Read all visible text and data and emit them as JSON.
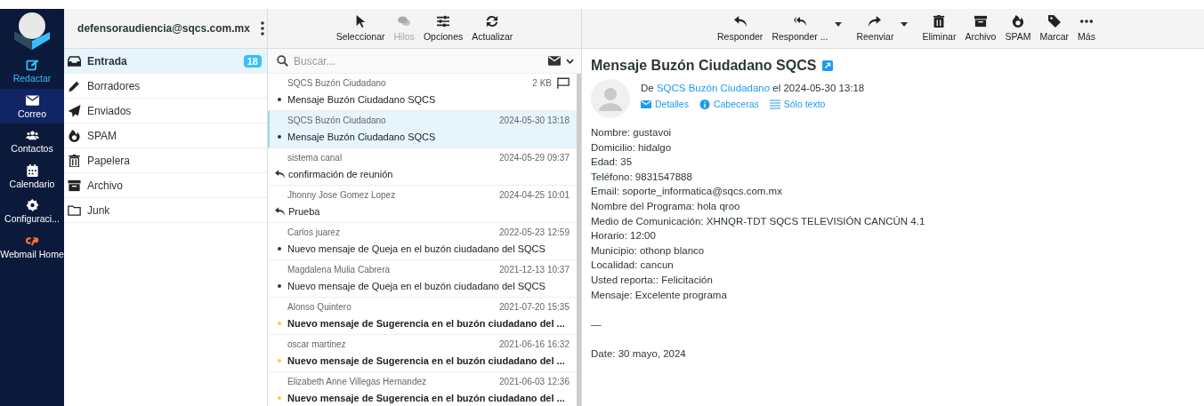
{
  "nav": [
    {
      "kind": "compose",
      "label": "Redactar",
      "selected": false,
      "accent": true
    },
    {
      "kind": "mail",
      "label": "Correo",
      "selected": true,
      "accent": false
    },
    {
      "kind": "contacts",
      "label": "Contactos",
      "selected": false,
      "accent": false
    },
    {
      "kind": "calendar",
      "label": "Calendario",
      "selected": false,
      "accent": false
    },
    {
      "kind": "settings",
      "label": "Configuraci...",
      "selected": false,
      "accent": false
    },
    {
      "kind": "cpanel",
      "label": "Webmail Home",
      "selected": false,
      "accent": false
    }
  ],
  "account": "defensoraudiencia@sqcs.com.mx",
  "folders": [
    {
      "kind": "inbox",
      "name": "Entrada",
      "selected": true,
      "count": "18"
    },
    {
      "kind": "drafts",
      "name": "Borradores",
      "selected": false
    },
    {
      "kind": "sent",
      "name": "Enviados",
      "selected": false
    },
    {
      "kind": "spam",
      "name": "SPAM",
      "selected": false
    },
    {
      "kind": "trash",
      "name": "Papelera",
      "selected": false
    },
    {
      "kind": "archive",
      "name": "Archivo",
      "selected": false
    },
    {
      "kind": "folder",
      "name": "Junk",
      "selected": false
    }
  ],
  "list_toolbar": [
    {
      "kind": "select",
      "label": "Seleccionar",
      "disabled": false
    },
    {
      "kind": "threads",
      "label": "Hilos",
      "disabled": true
    },
    {
      "kind": "options",
      "label": "Opciones",
      "disabled": false
    },
    {
      "kind": "refresh",
      "label": "Actualizar",
      "disabled": false
    }
  ],
  "search": {
    "placeholder": "Buscar..."
  },
  "messages": [
    {
      "from": "SQCS Buzón Ciudadano",
      "meta": "2 KB",
      "flag": true,
      "subject": "Mensaje Buzón Ciudadano SQCS",
      "kind": "read",
      "selected": false
    },
    {
      "from": "SQCS Buzón Ciudadano",
      "meta": "2024-05-30 13:18",
      "flag": false,
      "subject": "Mensaje Buzón Ciudadano SQCS",
      "kind": "read",
      "selected": true
    },
    {
      "from": "sistema canal",
      "meta": "2024-05-29 09:37",
      "flag": false,
      "subject": "confirmación de reunión",
      "kind": "replied",
      "selected": false
    },
    {
      "from": "Jhonny Jose Gomez Lopez",
      "meta": "2024-04-25 10:01",
      "flag": false,
      "subject": "Prueba",
      "kind": "replied",
      "selected": false
    },
    {
      "from": "Carlos juarez",
      "meta": "2022-05-23 12:59",
      "flag": false,
      "subject": "Nuevo mensaje de Queja en el buzón ciudadano del SQCS",
      "kind": "read",
      "selected": false
    },
    {
      "from": "Magdalena Mulia Cabrera",
      "meta": "2021-12-13 10:37",
      "flag": false,
      "subject": "Nuevo mensaje de Queja en el buzón ciudadano del SQCS",
      "kind": "read",
      "selected": false
    },
    {
      "from": "Alonso Quintero",
      "meta": "2021-07-20 15:35",
      "flag": false,
      "subject": "Nuevo mensaje de Sugerencia en el buzón ciudadano del ...",
      "kind": "unread",
      "selected": false
    },
    {
      "from": "oscar martinez",
      "meta": "2021-06-16 16:32",
      "flag": false,
      "subject": "Nuevo mensaje de Sugerencia en el buzón ciudadano del ...",
      "kind": "unread",
      "selected": false
    },
    {
      "from": "Elizabeth Anne Villegas Hernandez",
      "meta": "2021-06-03 12:36",
      "flag": false,
      "subject": "Nuevo mensaje de Sugerencia en el buzón ciudadano del ...",
      "kind": "unread",
      "selected": false
    }
  ],
  "message_toolbar": [
    {
      "kind": "reply",
      "label": "Responder",
      "dropdown": false
    },
    {
      "kind": "reply-all",
      "label": "Responder ...",
      "dropdown": true
    },
    {
      "kind": "forward",
      "label": "Reenviar",
      "dropdown": true
    },
    {
      "kind": "delete",
      "label": "Eliminar",
      "dropdown": false
    },
    {
      "kind": "archive",
      "label": "Archivo",
      "dropdown": false
    },
    {
      "kind": "spam",
      "label": "SPAM",
      "dropdown": false
    },
    {
      "kind": "tag",
      "label": "Marcar",
      "dropdown": false
    },
    {
      "kind": "more",
      "label": "Más",
      "dropdown": false
    }
  ],
  "message": {
    "subject": "Mensaje Buzón Ciudadano SQCS",
    "from_prefix": "De",
    "sender": "SQCS Buzón Ciudadano",
    "date_text": "el 2024-05-30 13:18",
    "links": [
      {
        "kind": "details",
        "label": "Detalles"
      },
      {
        "kind": "headers",
        "label": "Cabeceras"
      },
      {
        "kind": "plain",
        "label": "Sólo texto"
      }
    ],
    "body": [
      "Nombre: gustavoi",
      "Domicilio: hidalgo",
      "Edad: 35",
      "Teléfono: 9831547888",
      "Email: soporte_informatica@sqcs.com.mx",
      "Nombre del Programa: hola qroo",
      "Medio de Comunicación: XHNQR-TDT SQCS TELEVISIÓN CANCÚN 4.1",
      "Horario: 12:00",
      "Municipio: othonp blanco",
      "Localidad: cancun",
      "Usted reporta:: Felicitación",
      "Mensaje: Excelente programa"
    ],
    "signature": "—",
    "date": "Date: 30 mayo, 2024"
  }
}
